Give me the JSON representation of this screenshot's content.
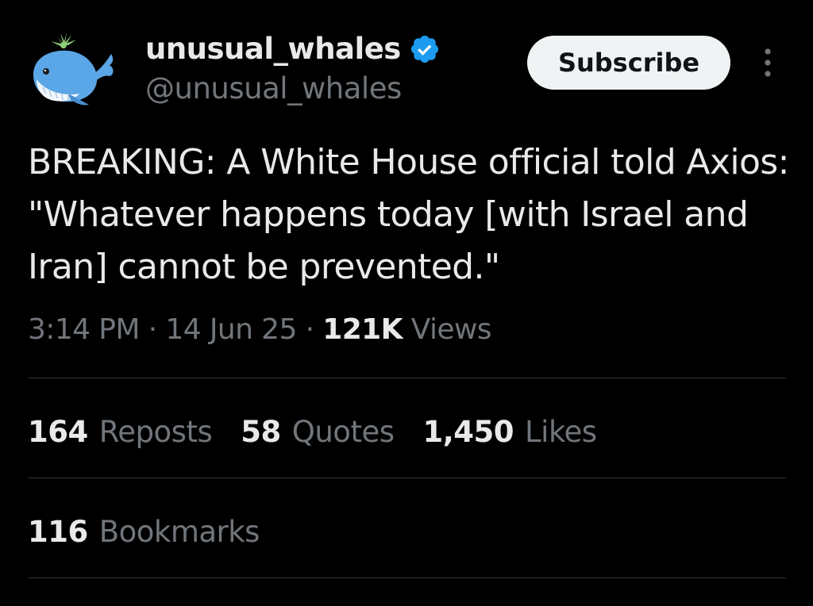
{
  "author": {
    "display_name": "unusual_whales",
    "handle": "@unusual_whales",
    "verified": true,
    "avatar_icon": "whale-icon",
    "verified_icon": "verified-badge-icon"
  },
  "header": {
    "subscribe_label": "Subscribe",
    "more_icon": "more-options-icon"
  },
  "tweet": {
    "text": "BREAKING: A White House official told Axios: \"Whatever happens today [with Israel and Iran] cannot be prevented.\"",
    "time": "3:14 PM",
    "separator": "·",
    "date": "14 Jun 25",
    "views_count": "121K",
    "views_label": "Views"
  },
  "stats": {
    "reposts": {
      "count": "164",
      "label": "Reposts"
    },
    "quotes": {
      "count": "58",
      "label": "Quotes"
    },
    "likes": {
      "count": "1,450",
      "label": "Likes"
    },
    "bookmarks": {
      "count": "116",
      "label": "Bookmarks"
    }
  },
  "colors": {
    "background": "#000000",
    "primary_text": "#e7e9ea",
    "secondary_text": "#71767b",
    "verified_blue": "#1d9bf0",
    "divider": "#2f3336",
    "button_bg": "#eff3f4"
  }
}
